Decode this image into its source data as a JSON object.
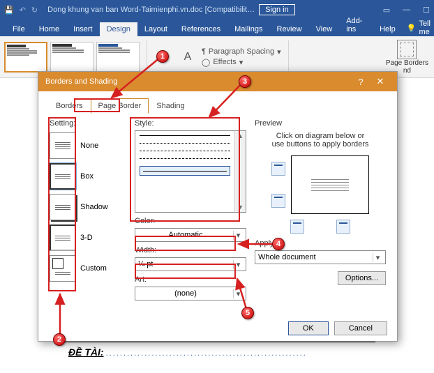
{
  "titlebar": {
    "doc": "Dong khung van ban Word-Taimienphi.vn.doc [Compatibilit…",
    "signin": "Sign in"
  },
  "ribbon": {
    "tabs": [
      "File",
      "Home",
      "Insert",
      "Design",
      "Layout",
      "References",
      "Mailings",
      "Review",
      "View",
      "Add-ins",
      "Help"
    ],
    "active": "Design",
    "tellme": "Tell me",
    "paraspacing": "Paragraph Spacing",
    "effects": "Effects",
    "pageborders": "Page Borders",
    "nd": "nd"
  },
  "dialog": {
    "title": "Borders and Shading",
    "tabs": {
      "borders": "Borders",
      "pageborder": "Page Border",
      "shading": "Shading"
    },
    "setting": {
      "label": "Setting:",
      "none": "None",
      "box": "Box",
      "shadow": "Shadow",
      "threed": "3-D",
      "custom": "Custom"
    },
    "style": {
      "label": "Style:"
    },
    "color": {
      "label": "Color:",
      "value": "Automatic"
    },
    "width": {
      "label": "Width:",
      "value": "¼ pt"
    },
    "art": {
      "label": "Art:",
      "value": "(none)"
    },
    "preview": {
      "label": "Preview",
      "text1": "Click on diagram below or",
      "text2": "use buttons to apply borders"
    },
    "applyto": {
      "label": "Apply to:",
      "value": "Whole document"
    },
    "options": "Options...",
    "ok": "OK",
    "cancel": "Cancel"
  },
  "annotations": {
    "1": "1",
    "2": "2",
    "3": "3",
    "4": "4",
    "5": "5"
  },
  "doc": {
    "detai": "ĐỀ TÀI:"
  }
}
